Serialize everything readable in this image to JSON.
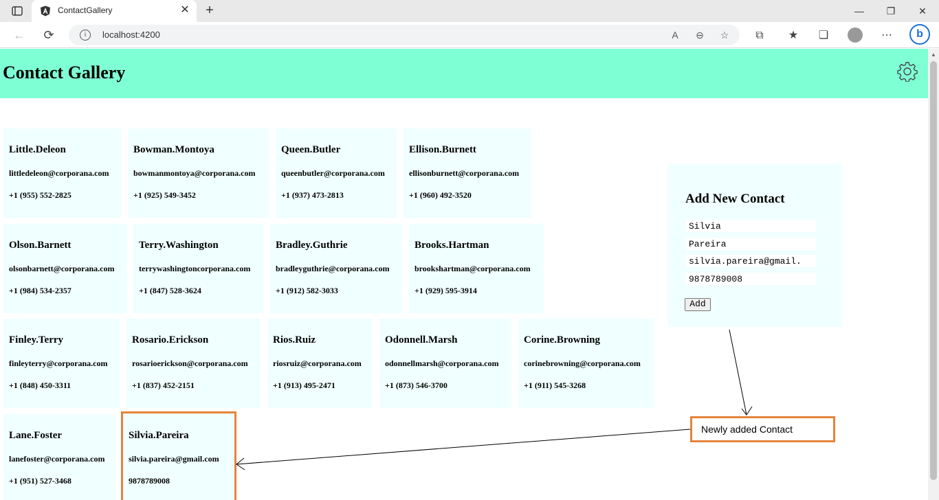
{
  "browser": {
    "tab_title": "ContactGallery",
    "address": "localhost:4200"
  },
  "header": {
    "title": "Contact Gallery"
  },
  "contacts": [
    {
      "name": "Little.Deleon",
      "email": "littledeleon@corporana.com",
      "phone": "+1 (955) 552-2825"
    },
    {
      "name": "Bowman.Montoya",
      "email": "bowmanmontoya@corporana.com",
      "phone": "+1 (925) 549-3452"
    },
    {
      "name": "Queen.Butler",
      "email": "queenbutler@corporana.com",
      "phone": "+1 (937) 473-2813"
    },
    {
      "name": "Ellison.Burnett",
      "email": "ellisonburnett@corporana.com",
      "phone": "+1 (960) 492-3520"
    },
    {
      "name": "Olson.Barnett",
      "email": "olsonbarnett@corporana.com",
      "phone": "+1 (984) 534-2357"
    },
    {
      "name": "Terry.Washington",
      "email": "terrywashingtoncorporana.com",
      "phone": "+1 (847) 528-3624"
    },
    {
      "name": "Bradley.Guthrie",
      "email": "bradleyguthrie@corporana.com",
      "phone": "+1 (912) 582-3033"
    },
    {
      "name": "Brooks.Hartman",
      "email": "brookshartman@corporana.com",
      "phone": "+1 (929) 595-3914"
    },
    {
      "name": "Finley.Terry",
      "email": "finleyterry@corporana.com",
      "phone": "+1 (848) 450-3311"
    },
    {
      "name": "Rosario.Erickson",
      "email": "rosarioerickson@corporana.com",
      "phone": "+1 (837) 452-2151"
    },
    {
      "name": "Rios.Ruiz",
      "email": "riosruiz@corporana.com",
      "phone": "+1 (913) 495-2471"
    },
    {
      "name": "Odonnell.Marsh",
      "email": "odonnellmarsh@corporana.com",
      "phone": "+1 (873) 546-3700"
    },
    {
      "name": "Corine.Browning",
      "email": "corinebrowning@corporana.com",
      "phone": "+1 (911) 545-3268"
    },
    {
      "name": "Lane.Foster",
      "email": "lanefoster@corporana.com",
      "phone": "+1 (951) 527-3468"
    },
    {
      "name": "Silvia.Pareira",
      "email": "silvia.pareira@gmail.com",
      "phone": "9878789008"
    }
  ],
  "add_form": {
    "title": "Add New Contact",
    "first_name": "Silvia",
    "last_name": "Pareira",
    "email": "silvia.pareira@gmail.",
    "phone": "9878789008",
    "add_label": "Add"
  },
  "annotation": {
    "text": "Newly added Contact",
    "color": "#e5843a"
  },
  "colors": {
    "header_bg": "#7fffd4",
    "card_bg": "#f0ffff"
  }
}
